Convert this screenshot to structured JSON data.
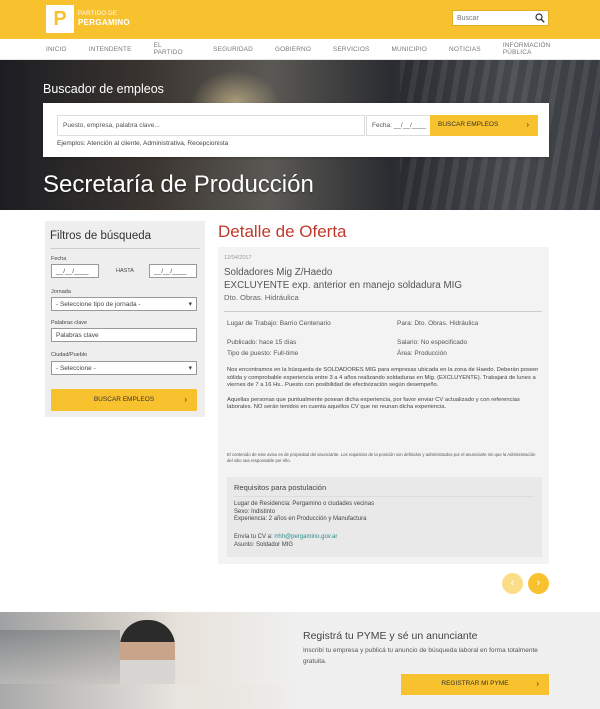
{
  "header": {
    "logo_letter": "P",
    "logo_line1": "PARTIDO DE",
    "logo_line2": "PERGAMINO",
    "search_placeholder": "Buscar",
    "search_icon": "search-icon"
  },
  "nav": [
    "INICIO",
    "INTENDENTE",
    "EL PARTIDO",
    "SEGURIDAD",
    "GOBIERNO",
    "SERVICIOS",
    "MUNICIPIO",
    "NOTICIAS",
    "INFORMACIÓN PÚBLICA"
  ],
  "hero": {
    "search_title": "Buscador de empleos",
    "keyword_placeholder": "Puesto, empresa, palabra clave...",
    "date_label": "Fecha: __/__/____",
    "search_button": "BUSCAR EMPLEOS",
    "examples": "Ejemplos:  Atención al cliente,  Administrativa,  Recepcionista",
    "section_title": "Secretaría de Producción"
  },
  "filters": {
    "title": "Filtros de búsqueda",
    "date_label": "Fecha",
    "date_from": "__/__/____",
    "date_sep": "HASTA",
    "date_to": "__/__/____",
    "jornada_label": "Jornada",
    "jornada_value": "- Seleccione tipo de jornada -",
    "keywords_label": "Palabras clave",
    "keywords_value": "Palabras clave",
    "city_label": "Ciudad/Pueblo",
    "city_value": "- Seleccione -",
    "button": "BUSCAR EMPLEOS"
  },
  "detail": {
    "heading": "Detalle de Oferta",
    "date": "12/04/2017",
    "title_line1": "Soldadores Mig Z/Haedo",
    "title_line2": "EXCLUYENTE exp. anterior en manejo soldadura MIG",
    "dept": "Dto. Obras. Hidráulica",
    "lugar": "Lugar de Trabajo: Barrio Centenario",
    "para": "Para: Dto. Obras. Hidráulica",
    "publicado": "Publicado: hace 15 días",
    "salario": "Salario: No especificado",
    "tipo": "Tipo de puesto: Full-time",
    "area": "Área: Producción",
    "desc1": "Nos encontramos en la búsqueda de  SOLDADORES MIG para empresas  ubicada en la zona de Haedo. Deberán poseer sólida y comprobable experiencia entre 3 a 4 años realizando soldaduras en Mig. (EXCLUYENTE). Trabajará de lunes a viernes de 7 a 16 Hs.. Puesto con posibilidad de efectivización según desempeño.",
    "desc2": "Aquellas personas que puntualmente posean dicha experiencia, por favor enviar CV actualizado y con referencias laborales. NO serán tenidos en cuenta aquellos CV que no reunan dicha experiencia.",
    "disclaimer": "El contenido de este aviso es de propiedad del anunciante. Los requisitos de la posición son definidos y administrados por el anunciante sin que la Administración del sitio sea responsable por ello.",
    "req_title": "Requisitos para postulación",
    "req_residencia": "Lugar de Residencia: Pergamino o ciudades vecinas",
    "req_sexo": "Sexo: Indistinto",
    "req_exp": "Experiencia: 2 años en Producción y Manufactura",
    "cv_label": "Envía tu CV a:",
    "cv_mail": "rrhh@pergamino.gov.ar",
    "asunto": "Asunto: Soldador MIG"
  },
  "pager": {
    "prev": "‹",
    "next": "›"
  },
  "promo": {
    "title": "Registrá tu PYME y sé un anunciante",
    "text": "Inscribí tu empresa y publicá tu anuncio de búsqueda laboral en forma totalmente gratuita.",
    "button": "REGISTRAR MI PYME"
  },
  "colors": {
    "accent": "#f8c22e",
    "heading_red": "#c0392b",
    "link": "#2a8c8c"
  }
}
